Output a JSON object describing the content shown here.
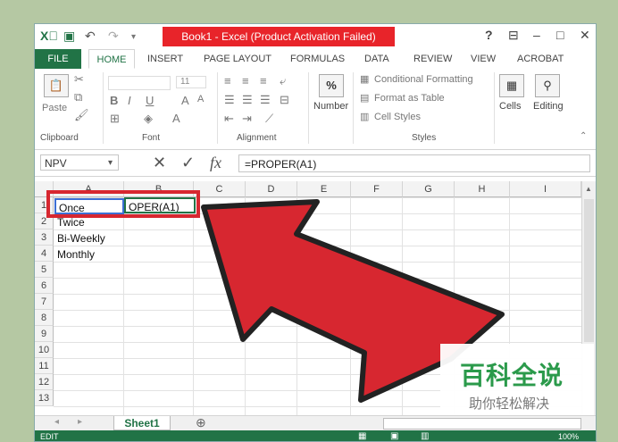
{
  "titlebar": {
    "title": "Book1 - Excel (Product Activation Failed)",
    "help": "?",
    "ribbon_display": "⊟",
    "minimize": "–",
    "maximize": "□",
    "close": "✕"
  },
  "tabs": [
    "FILE",
    "HOME",
    "INSERT",
    "PAGE LAYOUT",
    "FORMULAS",
    "DATA",
    "REVIEW",
    "VIEW",
    "ACROBAT"
  ],
  "ribbon": {
    "clipboard": {
      "label": "Clipboard",
      "paste": "Paste"
    },
    "font": {
      "label": "Font",
      "size": "11"
    },
    "alignment": {
      "label": "Alignment"
    },
    "number": {
      "label": "Number",
      "symbol": "%"
    },
    "styles": {
      "label": "Styles",
      "conditional": "Conditional Formatting",
      "format_table": "Format as Table",
      "cell_styles": "Cell Styles"
    },
    "cells": {
      "label": "Cells"
    },
    "editing": {
      "label": "Editing"
    }
  },
  "formula_bar": {
    "name_box": "NPV",
    "formula": "=PROPER(A1)"
  },
  "columns": [
    "A",
    "B",
    "C",
    "D",
    "E",
    "F",
    "G",
    "H",
    "I"
  ],
  "rows": [
    "1",
    "2",
    "3",
    "4",
    "5",
    "6",
    "7",
    "8",
    "9",
    "10",
    "11",
    "12",
    "13"
  ],
  "cells": {
    "A1": "Once",
    "B1": "OPER(A1)",
    "A2": "Twice",
    "A3": "Bi-Weekly",
    "A4": "Monthly"
  },
  "sheet": {
    "name": "Sheet1",
    "add": "⊕"
  },
  "status": {
    "mode": "EDIT",
    "zoom": "100%"
  },
  "watermark": {
    "title": "百科全说",
    "subtitle": "助你轻松解决"
  },
  "colors": {
    "excel_green": "#217346",
    "highlight_red": "#d72730",
    "title_red": "#e8242a"
  }
}
